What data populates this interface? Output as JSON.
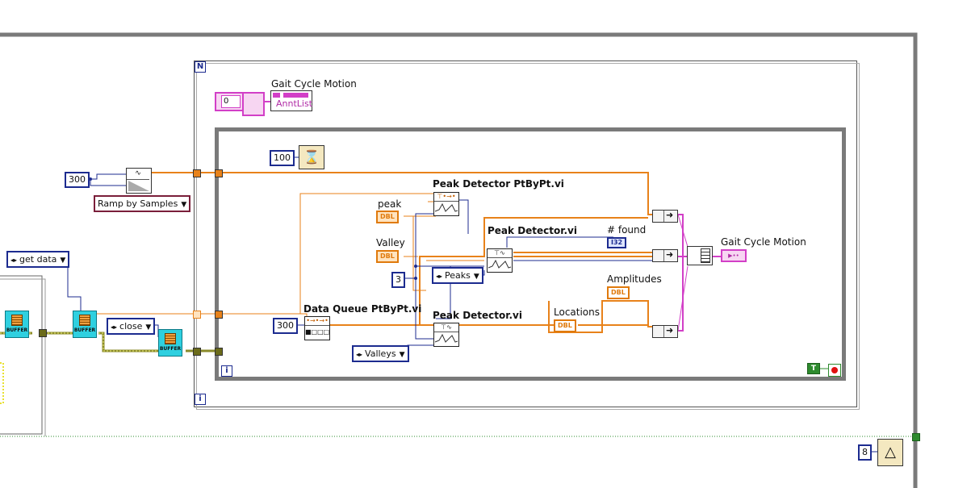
{
  "diagram": {
    "outer_loop": {
      "index_label": "i",
      "count_label": "N"
    },
    "inner_loop": {
      "index_label": "i",
      "stop_constant": "T"
    },
    "gait_cycle_top": {
      "label": "Gait Cycle Motion",
      "index_value": "0",
      "type_label": "AnntList"
    },
    "wait_constant": "100",
    "metronome_constant": "8",
    "left_section": {
      "samples_constant": "300",
      "ramp_mode": "Ramp by Samples",
      "get_data": "get data",
      "close": "close",
      "buffer_label": "BUFFER"
    },
    "peak_detector_ptbypt": {
      "title": "Peak Detector PtByPt.vi",
      "input_label": "peak",
      "input_type": "DBL"
    },
    "valley": {
      "label": "Valley",
      "type": "DBL"
    },
    "width_constant": "3",
    "peaks_ring": "Peaks",
    "valleys_ring": "Valleys",
    "peak_detector_1": {
      "title": "Peak Detector.vi"
    },
    "peak_detector_2": {
      "title": "Peak Detector.vi"
    },
    "found_indicator": {
      "label": "# found",
      "type": "I32"
    },
    "data_queue": {
      "title": "Data Queue PtByPt.vi",
      "size_constant": "300"
    },
    "locations": {
      "label": "Locations",
      "type": "DBL"
    },
    "amplitudes": {
      "label": "Amplitudes",
      "type": "DBL"
    },
    "gait_cycle_output": {
      "label": "Gait Cycle Motion"
    }
  },
  "colors": {
    "orange_wire": "#e8821a",
    "blue_wire": "#1c2b8f",
    "pink_wire": "#d23fc7",
    "frame": "#7a7a7a",
    "green_dash": "#2e8b2e",
    "olive": "#8a8a2a"
  }
}
